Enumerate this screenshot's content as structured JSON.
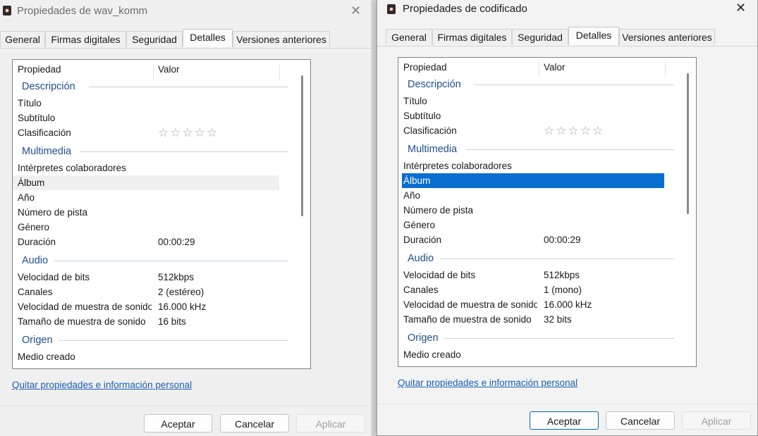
{
  "left": {
    "title": "Propiedades de wav_komm",
    "tabs": [
      "General",
      "Firmas digitales",
      "Seguridad",
      "Detalles",
      "Versiones anteriores"
    ],
    "active_tab": "Detalles",
    "columns": [
      "Propiedad",
      "Valor"
    ],
    "groups": [
      "Descripción",
      "Multimedia",
      "Audio",
      "Origen"
    ],
    "desc": {
      "titulo": "Título",
      "subtitulo": "Subtítulo",
      "clasificacion": "Clasificación"
    },
    "media": {
      "interpretes": "Intérpretes colaboradores",
      "album": "Álbum",
      "anio": "Año",
      "pista": "Número de pista",
      "genero": "Género",
      "duracion": "Duración",
      "duracion_val": "00:00:29"
    },
    "audio": {
      "bits": "Velocidad de bits",
      "bits_val": "512kbps",
      "canales": "Canales",
      "canales_val": "2 (estéreo)",
      "muestra": "Velocidad de muestra de sonido",
      "muestra_val": "16.000 kHz",
      "tamano": "Tamaño de muestra de sonido",
      "tamano_val": "16 bits"
    },
    "origen": {
      "medio": "Medio creado"
    },
    "rating": "☆☆☆☆☆",
    "link": "Quitar propiedades e información personal",
    "buttons": {
      "ok": "Aceptar",
      "cancel": "Cancelar",
      "apply": "Aplicar"
    }
  },
  "right": {
    "title": "Propiedades de codificado",
    "tabs": [
      "General",
      "Firmas digitales",
      "Seguridad",
      "Detalles",
      "Versiones anteriores"
    ],
    "active_tab": "Detalles",
    "columns": [
      "Propiedad",
      "Valor"
    ],
    "groups": [
      "Descripción",
      "Multimedia",
      "Audio",
      "Origen"
    ],
    "desc": {
      "titulo": "Título",
      "subtitulo": "Subtítulo",
      "clasificacion": "Clasificación"
    },
    "media": {
      "interpretes": "Intérpretes colaboradores",
      "album": "Álbum",
      "anio": "Año",
      "pista": "Número de pista",
      "genero": "Género",
      "duracion": "Duración",
      "duracion_val": "00:00:29"
    },
    "audio": {
      "bits": "Velocidad de bits",
      "bits_val": "512kbps",
      "canales": "Canales",
      "canales_val": "1 (mono)",
      "muestra": "Velocidad de muestra de sonido",
      "muestra_val": "16.000 kHz",
      "tamano": "Tamaño de muestra de sonido",
      "tamano_val": "32 bits"
    },
    "origen": {
      "medio": "Medio creado"
    },
    "rating": "☆☆☆☆☆",
    "link": "Quitar propiedades e información personal",
    "buttons": {
      "ok": "Aceptar",
      "cancel": "Cancelar",
      "apply": "Aplicar"
    }
  },
  "colors": {
    "accent": "#0067c0",
    "selection": "#0a6ed1",
    "group_heading": "#1f4f8f",
    "link": "#1a5fb4"
  },
  "icons": {
    "app": "media-file-icon",
    "close": "close-icon",
    "star": "star-icon"
  }
}
